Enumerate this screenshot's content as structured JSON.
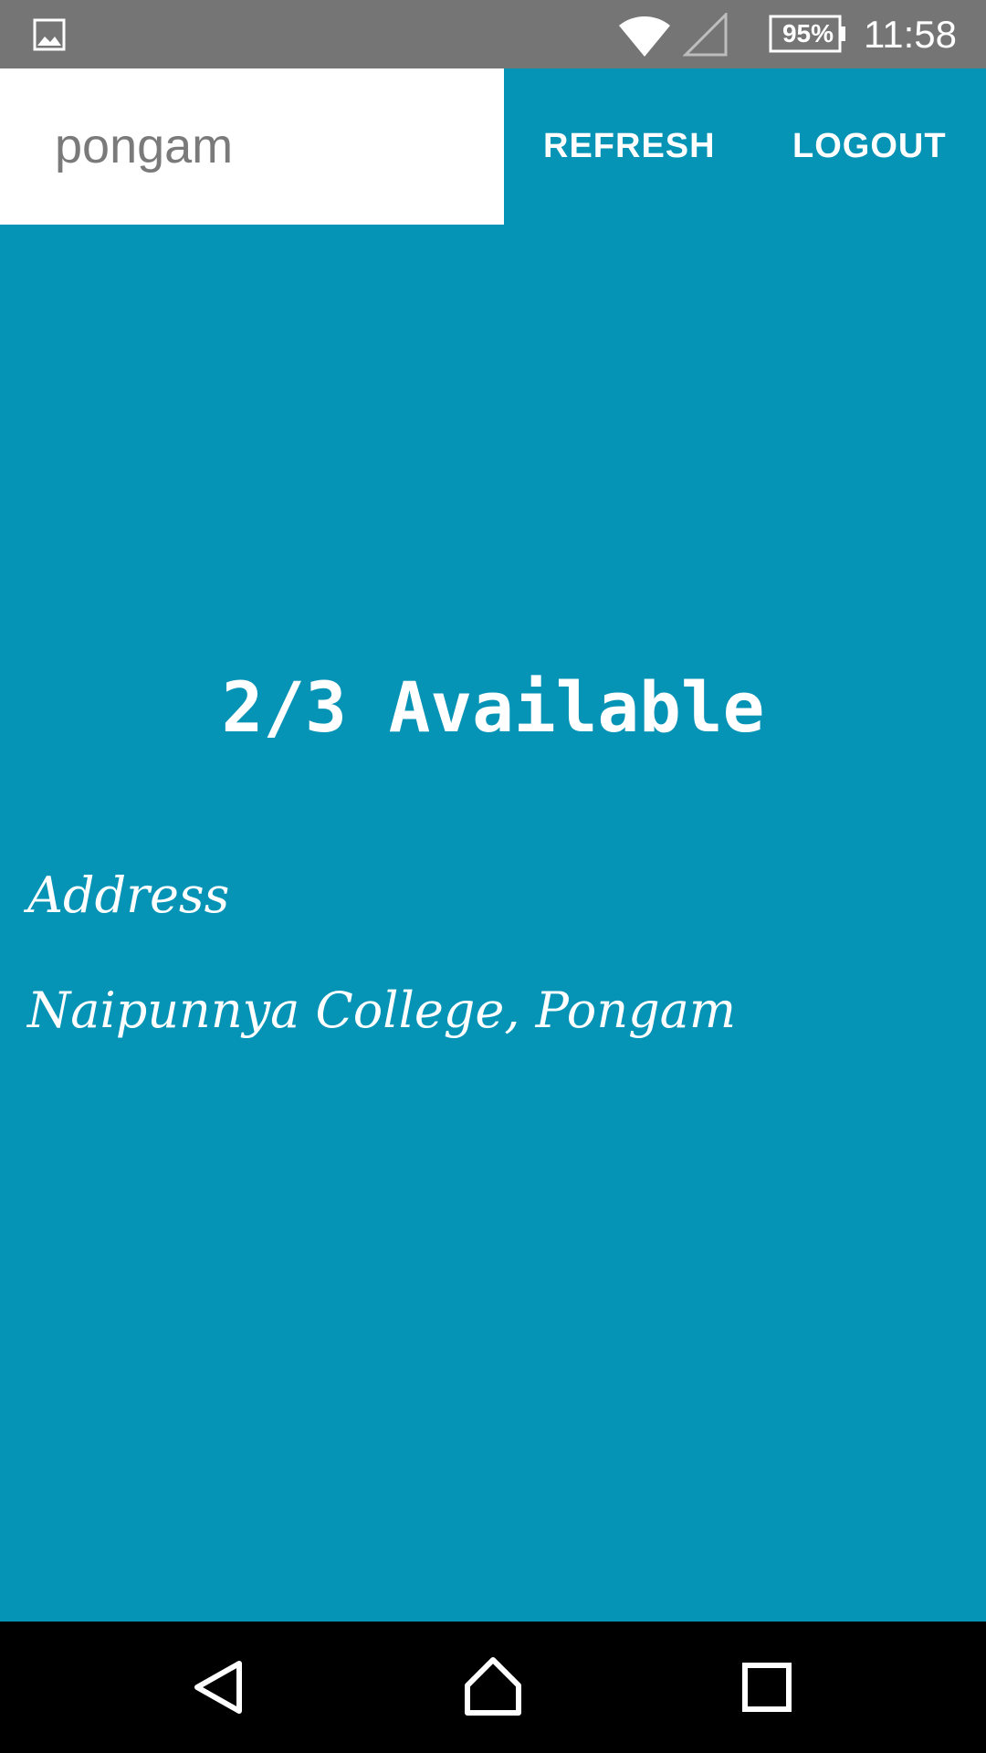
{
  "status_bar": {
    "battery": "95%",
    "time": "11:58",
    "icons": [
      "gallery-notification-icon",
      "wifi-icon",
      "cell-signal-icon",
      "battery-icon"
    ]
  },
  "app_bar": {
    "title": "pongam",
    "actions": {
      "refresh_label": "REFRESH",
      "logout_label": "LOGOUT"
    }
  },
  "main": {
    "availability": "2/3 Available",
    "address_label": "Address",
    "address_value": "Naipunnya College, Pongam"
  },
  "nav_bar": {
    "icons": [
      "back-icon",
      "home-icon",
      "recents-icon"
    ]
  },
  "colors": {
    "primary": "#0593b6",
    "status_bar": "#757575",
    "nav_bar": "#000000",
    "title_text": "#7a7a7a"
  }
}
